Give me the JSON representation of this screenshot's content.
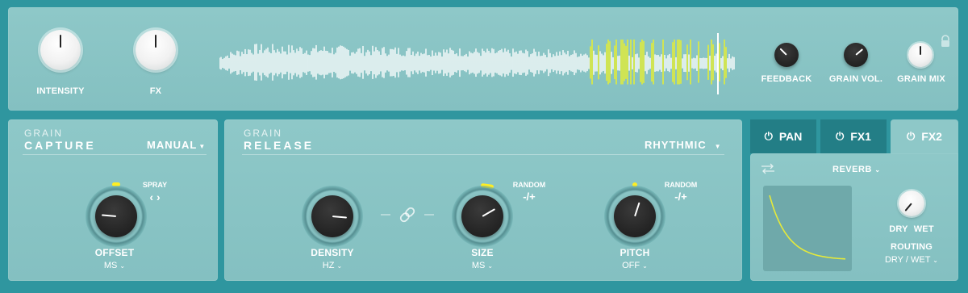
{
  "top": {
    "intensity_label": "INTENSITY",
    "fx_label": "FX",
    "feedback_label": "FEEDBACK",
    "grain_vol_label": "GRAIN VOL.",
    "grain_mix_label": "GRAIN MIX",
    "lock_icon": "lock-icon"
  },
  "capture": {
    "title_small": "GRAIN",
    "title_big": "CAPTURE",
    "mode": "MANUAL",
    "spray_label": "SPRAY",
    "spray_arrows": "‹ ›",
    "offset_label": "OFFSET",
    "offset_unit": "MS"
  },
  "release": {
    "title_small": "GRAIN",
    "title_big": "RELEASE",
    "mode": "RHYTHMIC",
    "density_label": "DENSITY",
    "density_unit": "HZ",
    "size_label": "SIZE",
    "size_unit": "MS",
    "size_random_label": "RANDOM",
    "size_random_value": "-/+",
    "pitch_label": "PITCH",
    "pitch_unit": "OFF",
    "pitch_random_label": "RANDOM",
    "pitch_random_value": "-/+"
  },
  "fx": {
    "tabs": [
      {
        "label": "PAN",
        "icon": "power-icon",
        "active": false
      },
      {
        "label": "FX1",
        "icon": "power-icon",
        "active": false
      },
      {
        "label": "FX2",
        "icon": "power-icon",
        "active": true
      }
    ],
    "effect": "REVERB",
    "dry_label": "DRY",
    "wet_label": "WET",
    "routing_label": "ROUTING",
    "routing_value": "DRY / WET"
  },
  "colors": {
    "background": "#2f969f",
    "panel": "#8ec8c8",
    "accent": "#ffee22",
    "tab_inactive": "#237e86"
  }
}
